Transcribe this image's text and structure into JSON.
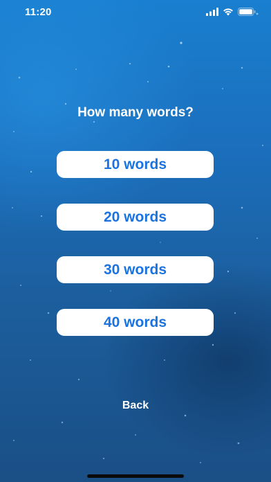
{
  "status_bar": {
    "time": "11:20",
    "icons": [
      "signal-icon",
      "wifi-icon",
      "battery-icon"
    ]
  },
  "prompt": {
    "title": "How many words?"
  },
  "options": [
    {
      "label": "10 words"
    },
    {
      "label": "20 words"
    },
    {
      "label": "30 words"
    },
    {
      "label": "40 words"
    }
  ],
  "navigation": {
    "back_label": "Back"
  },
  "colors": {
    "button_text": "#1a73e0",
    "button_background": "#ffffff",
    "background_top": "#1a7fd0",
    "background_bottom": "#1a4f85"
  }
}
